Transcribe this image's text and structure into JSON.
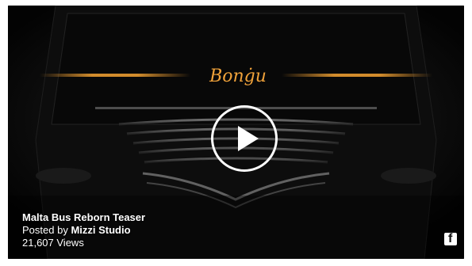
{
  "video": {
    "title": "Malta Bus Reborn Teaser",
    "posted_prefix": "Posted by ",
    "author": "Mizzi Studio",
    "views": "21,607 Views",
    "brand_text": "Bonġu"
  },
  "icons": {
    "play": "play-icon",
    "facebook": "facebook-icon",
    "facebook_glyph": "f"
  },
  "colors": {
    "background": "#050505",
    "accent_amber": "#e89a30",
    "overlay_text": "#ffffff"
  }
}
